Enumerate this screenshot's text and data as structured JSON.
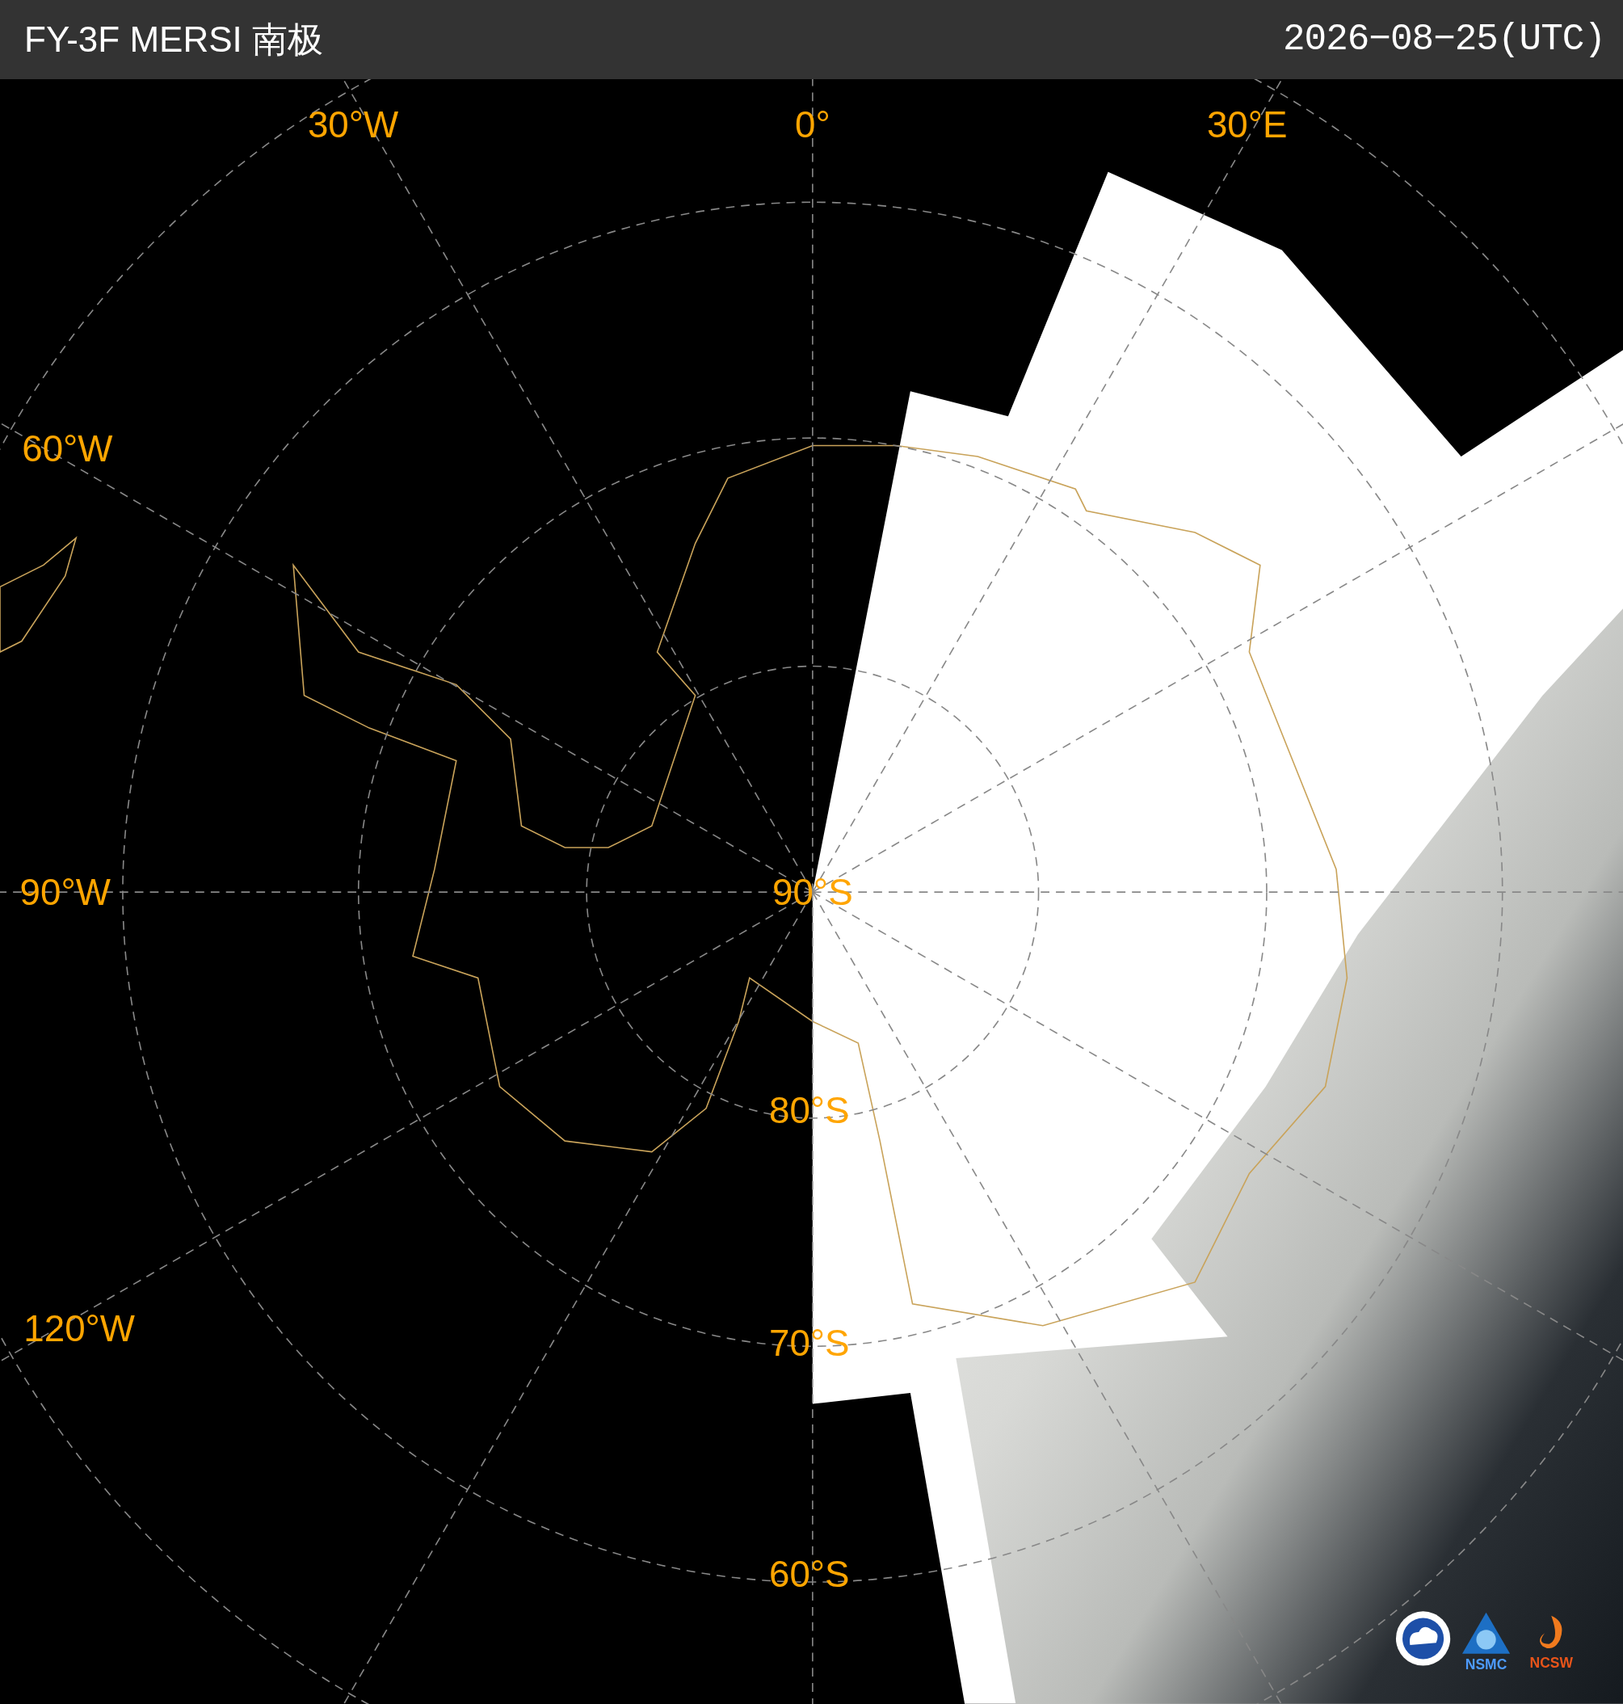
{
  "header": {
    "title": "FY-3F MERSI 南极",
    "date": "2026−08−25(UTC)"
  },
  "map": {
    "longitude_labels": [
      "30°W",
      "0°",
      "30°E",
      "60°W",
      "90°W",
      "120°W"
    ],
    "latitude_labels": [
      "90°S",
      "80°S",
      "70°S",
      "60°S"
    ]
  },
  "logos": [
    {
      "kind": "cma"
    },
    {
      "kind": "nsmc",
      "label": "NSMC"
    },
    {
      "kind": "ncsw",
      "label": "NCSW"
    }
  ]
}
